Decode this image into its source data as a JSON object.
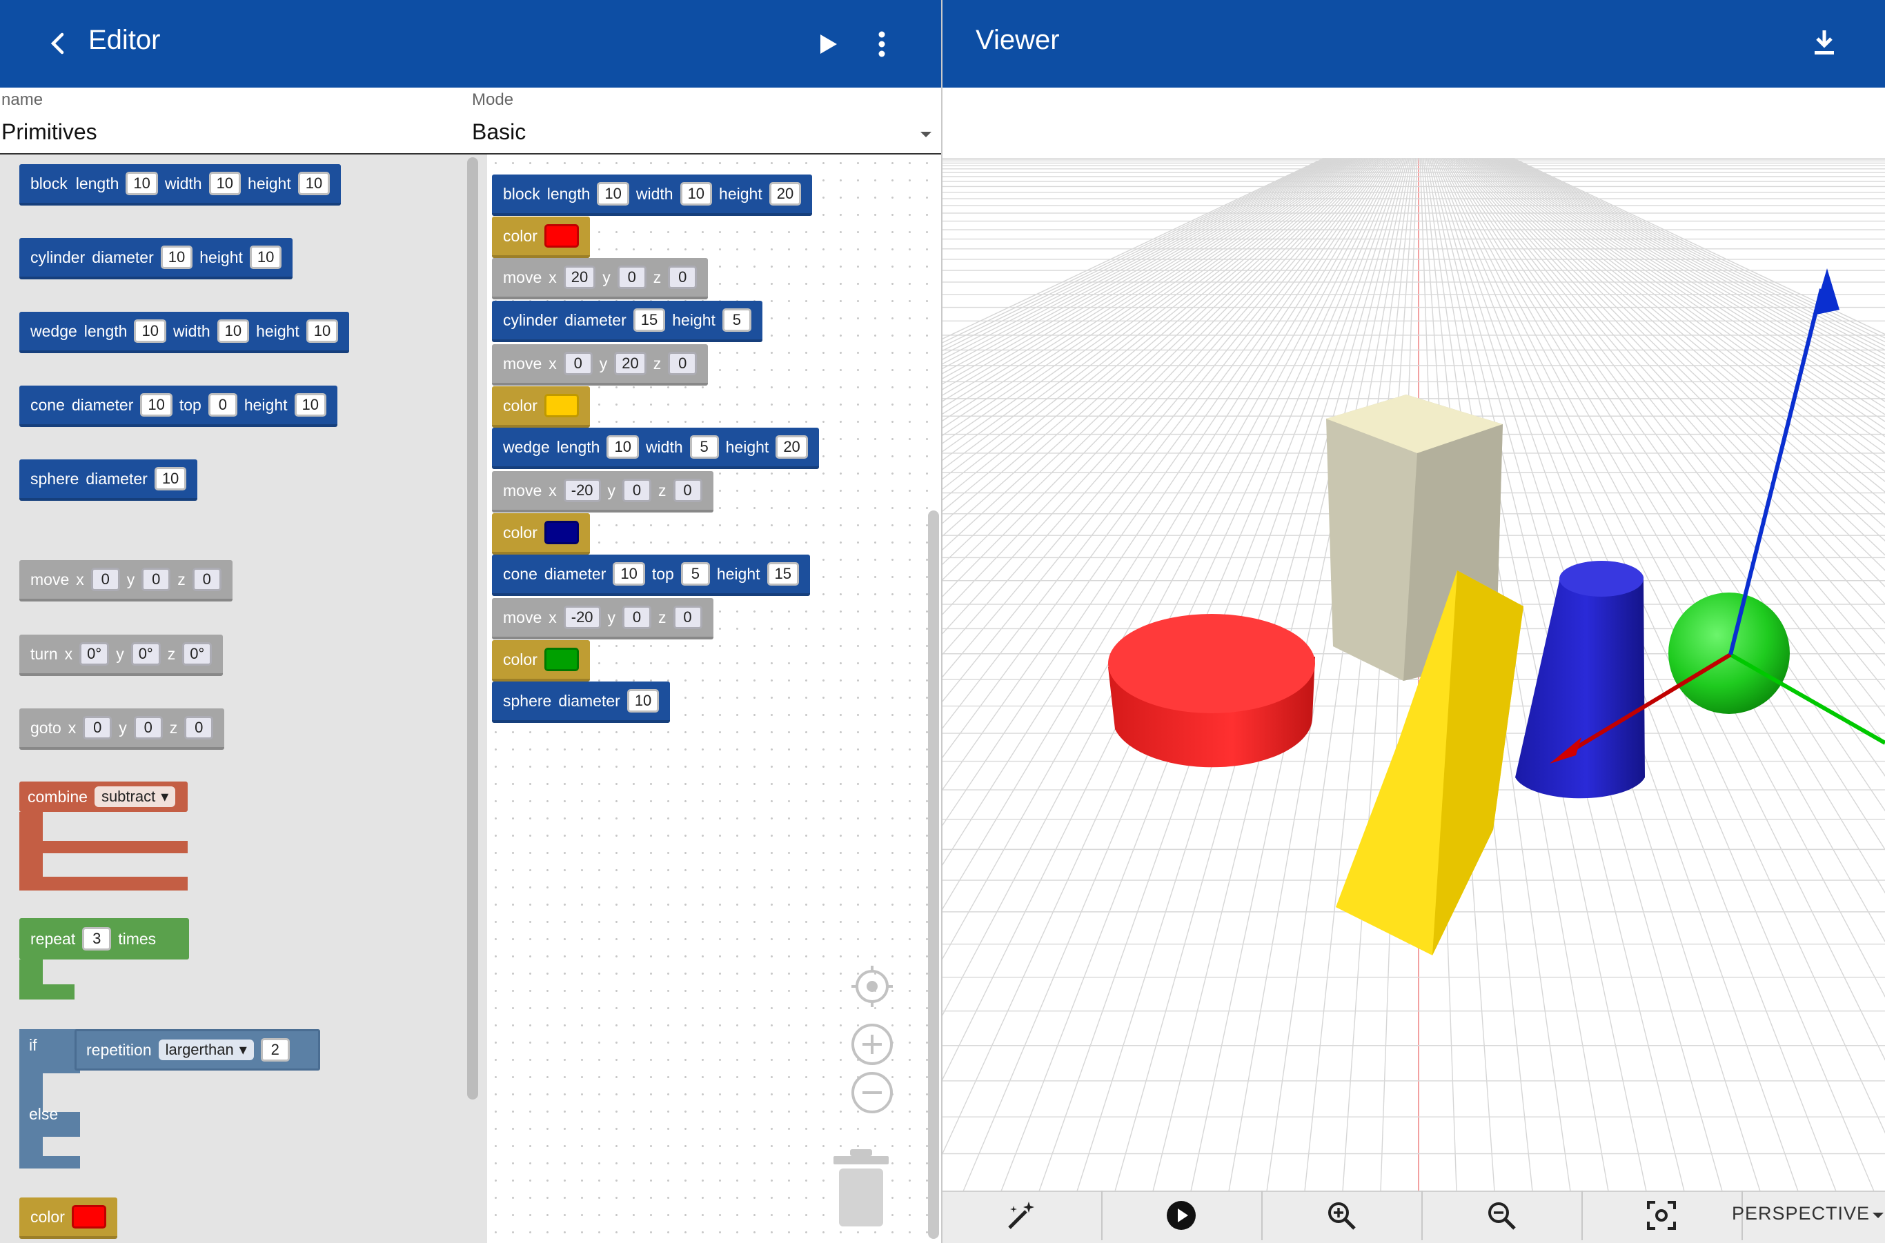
{
  "editor": {
    "title": "Editor",
    "back_icon": "chevron-left-icon",
    "run_icon": "play-icon",
    "menu_icon": "more-vert-icon"
  },
  "fields": {
    "name_label": "name",
    "name_value": "Primitives",
    "mode_label": "Mode",
    "mode_value": "Basic"
  },
  "toolbox": {
    "block": {
      "kw": "block",
      "length_label": "length",
      "length": "10",
      "width_label": "width",
      "width": "10",
      "height_label": "height",
      "height": "10"
    },
    "cylinder": {
      "kw": "cylinder",
      "diameter_label": "diameter",
      "diameter": "10",
      "height_label": "height",
      "height": "10"
    },
    "wedge": {
      "kw": "wedge",
      "length_label": "length",
      "length": "10",
      "width_label": "width",
      "width": "10",
      "height_label": "height",
      "height": "10"
    },
    "cone": {
      "kw": "cone",
      "diameter_label": "diameter",
      "diameter": "10",
      "top_label": "top",
      "top": "0",
      "height_label": "height",
      "height": "10"
    },
    "sphere": {
      "kw": "sphere",
      "diameter_label": "diameter",
      "diameter": "10"
    },
    "move": {
      "kw": "move",
      "x_label": "x",
      "x": "0",
      "y_label": "y",
      "y": "0",
      "z_label": "z",
      "z": "0"
    },
    "turn": {
      "kw": "turn",
      "x_label": "x",
      "x": "0°",
      "y_label": "y",
      "y": "0°",
      "z_label": "z",
      "z": "0°"
    },
    "goto": {
      "kw": "goto",
      "x_label": "x",
      "x": "0",
      "y_label": "y",
      "y": "0",
      "z_label": "z",
      "z": "0"
    },
    "combine": {
      "kw": "combine",
      "option": "subtract"
    },
    "repeat": {
      "kw": "repeat",
      "count": "3",
      "times_label": "times"
    },
    "if": {
      "if_kw": "if",
      "else_kw": "else",
      "cond_kw": "repetition",
      "op": "largerthan",
      "value": "2"
    },
    "color": {
      "kw": "color",
      "swatch": "#ff0000"
    }
  },
  "program": {
    "b1": {
      "kw": "block",
      "length_label": "length",
      "length": "10",
      "width_label": "width",
      "width": "10",
      "height_label": "height",
      "height": "20"
    },
    "c1": {
      "kw": "color",
      "swatch": "#ff0000"
    },
    "m1": {
      "kw": "move",
      "x_label": "x",
      "x": "20",
      "y_label": "y",
      "y": "0",
      "z_label": "z",
      "z": "0"
    },
    "cyl": {
      "kw": "cylinder",
      "diameter_label": "diameter",
      "diameter": "15",
      "height_label": "height",
      "height": "5"
    },
    "m2": {
      "kw": "move",
      "x_label": "x",
      "x": "0",
      "y_label": "y",
      "y": "20",
      "z_label": "z",
      "z": "0"
    },
    "c2": {
      "kw": "color",
      "swatch": "#ffcc00"
    },
    "wed": {
      "kw": "wedge",
      "length_label": "length",
      "length": "10",
      "width_label": "width",
      "width": "5",
      "height_label": "height",
      "height": "20"
    },
    "m3": {
      "kw": "move",
      "x_label": "x",
      "x": "-20",
      "y_label": "y",
      "y": "0",
      "z_label": "z",
      "z": "0"
    },
    "c3": {
      "kw": "color",
      "swatch": "#00008b"
    },
    "con": {
      "kw": "cone",
      "diameter_label": "diameter",
      "diameter": "10",
      "top_label": "top",
      "top": "5",
      "height_label": "height",
      "height": "15"
    },
    "m4": {
      "kw": "move",
      "x_label": "x",
      "x": "-20",
      "y_label": "y",
      "y": "0",
      "z_label": "z",
      "z": "0"
    },
    "c4": {
      "kw": "color",
      "swatch": "#00a000"
    },
    "sph": {
      "kw": "sphere",
      "diameter_label": "diameter",
      "diameter": "10"
    }
  },
  "workspace_controls": [
    "recenter-icon",
    "zoom-in-icon",
    "zoom-out-icon",
    "trash-icon"
  ],
  "viewer": {
    "title": "Viewer",
    "download_icon": "download-icon",
    "toolbar": {
      "items": [
        "magic-wand-icon",
        "play-circle-icon",
        "zoom-in-icon",
        "zoom-out-icon",
        "focus-icon"
      ],
      "projection": "PERSPECTIVE"
    }
  },
  "colors": {
    "appbar": "#0d4ea4",
    "shape_block": "#ece9c8",
    "shape_cylinder": "#ff2a2a",
    "shape_wedge": "#ffe420",
    "shape_cone": "#2424c8",
    "shape_sphere": "#1ecf1e",
    "axis_x": "#e00000",
    "axis_y": "#00cc00",
    "axis_z": "#0033cc"
  }
}
